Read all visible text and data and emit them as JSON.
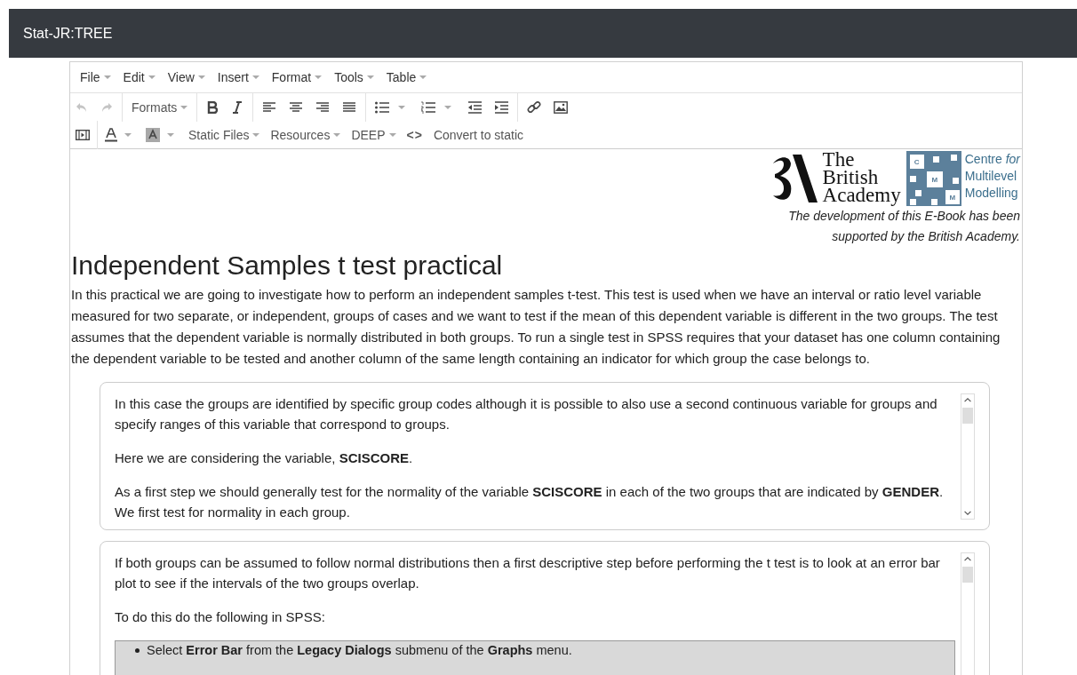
{
  "app_bar": {
    "title": "Stat-JR:TREE"
  },
  "menu_bar": [
    "File",
    "Edit",
    "View",
    "Insert",
    "Format",
    "Tools",
    "Table"
  ],
  "toolbar": {
    "formats": "Formats",
    "dropdowns": [
      "Static Files",
      "Resources",
      "DEEP"
    ],
    "code": "<>",
    "convert": "Convert to static"
  },
  "sponsor": {
    "academy_lines": [
      "The",
      "British",
      "Academy"
    ],
    "cmm_letters": [
      "C",
      "M",
      "M"
    ],
    "cmm_name": [
      "Centre *for*",
      "Multilevel",
      "Modelling"
    ],
    "caption": [
      "The development of this E-Book has been",
      "supported by the British Academy."
    ]
  },
  "heading": "Independent Samples t test practical",
  "intro": "In this practical we are going to investigate how to perform an independent samples t-test. This test is used when we have an interval or ratio level variable measured for two separate, or independent, groups of cases and we want to test if the mean of this dependent variable is different in the two groups. The test assumes that the dependent variable is normally distributed in both groups. To run a single test in SPSS requires that your dataset has one column containing the dependent variable to be tested and another column of the same length containing an indicator for which group the case belongs to.",
  "panels": [
    {
      "paragraphs": [
        "In this case the groups are identified by specific group codes although it is possible to also use a second continuous variable for groups and specify ranges of this variable that correspond to groups.",
        "Here we are considering the variable, **SCISCORE**.",
        "As a first step we should generally test for the normality of the variable **SCISCORE** in each of the two groups that are indicated by **GENDER**. We first test for normality in each group."
      ]
    },
    {
      "paragraphs": [
        "If both groups can be assumed to follow normal distributions then a first descriptive step before performing the t test is to look at an error bar plot to see if the intervals of the two groups overlap.",
        "To do this do the following in SPSS:"
      ],
      "steps": [
        "Select **Error Bar** from the **Legacy Dialogs** submenu of the **Graphs** menu."
      ]
    }
  ]
}
